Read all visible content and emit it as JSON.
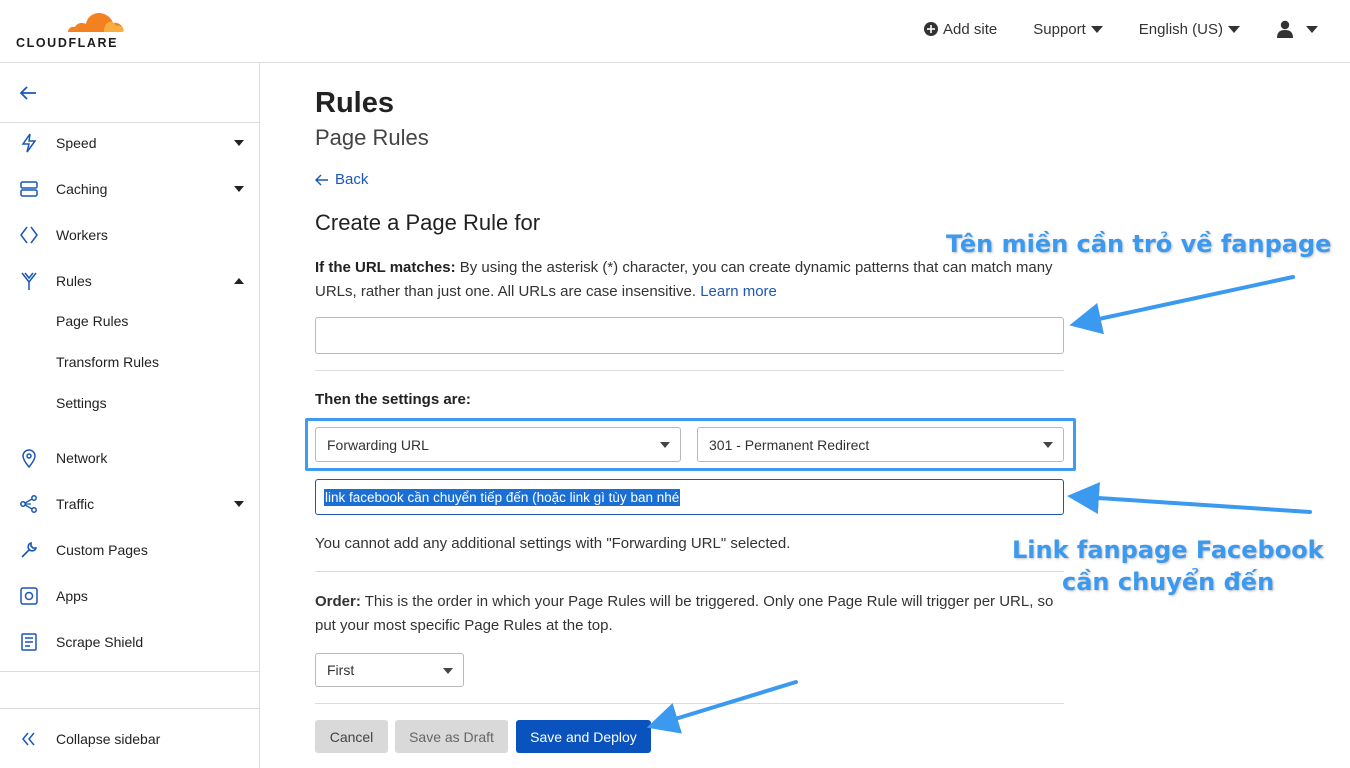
{
  "header": {
    "logo_text": "CLOUDFLARE",
    "add_site": "Add site",
    "support": "Support",
    "language": "English (US)"
  },
  "sidebar": {
    "items": [
      {
        "label": "Speed",
        "icon": "lightning-icon",
        "dropdown": "down"
      },
      {
        "label": "Caching",
        "icon": "server-icon",
        "dropdown": "down"
      },
      {
        "label": "Workers",
        "icon": "workers-icon",
        "dropdown": ""
      },
      {
        "label": "Rules",
        "icon": "rules-icon",
        "dropdown": "up"
      },
      {
        "label": "Network",
        "icon": "location-pin-icon",
        "dropdown": ""
      },
      {
        "label": "Traffic",
        "icon": "traffic-icon",
        "dropdown": "down"
      },
      {
        "label": "Custom Pages",
        "icon": "wrench-icon",
        "dropdown": ""
      },
      {
        "label": "Apps",
        "icon": "apps-icon",
        "dropdown": ""
      },
      {
        "label": "Scrape Shield",
        "icon": "document-icon",
        "dropdown": ""
      }
    ],
    "rules_subitems": [
      "Page Rules",
      "Transform Rules",
      "Settings"
    ],
    "collapse": "Collapse sidebar"
  },
  "main": {
    "title": "Rules",
    "subtitle": "Page Rules",
    "back": "Back",
    "create_heading": "Create a Page Rule for",
    "url_matches_label": "If the URL matches:",
    "url_matches_desc": " By using the asterisk (*) character, you can create dynamic patterns that can match many URLs, rather than just one. All URLs are case insensitive. ",
    "learn_more": "Learn more",
    "url_value": "",
    "settings_label": "Then the settings are:",
    "setting_select": "Forwarding URL",
    "status_select": "301 - Permanent Redirect",
    "forward_value": "link facebook cần chuyển tiếp đến (hoặc link gì tùy ban nhé",
    "note": "You cannot add any additional settings with \"Forwarding URL\" selected.",
    "order_label": "Order:",
    "order_desc": " This is the order in which your Page Rules will be triggered. Only one Page Rule will trigger per URL, so put your most specific Page Rules at the top.",
    "order_select": "First",
    "buttons": {
      "cancel": "Cancel",
      "draft": "Save as Draft",
      "deploy": "Save and Deploy"
    }
  },
  "annotations": {
    "domain_note": "Tên miền cần trỏ về fanpage",
    "link_note_line1": "Link fanpage Facebook",
    "link_note_line2": "cần chuyển đến",
    "color": "#3b9af0"
  }
}
